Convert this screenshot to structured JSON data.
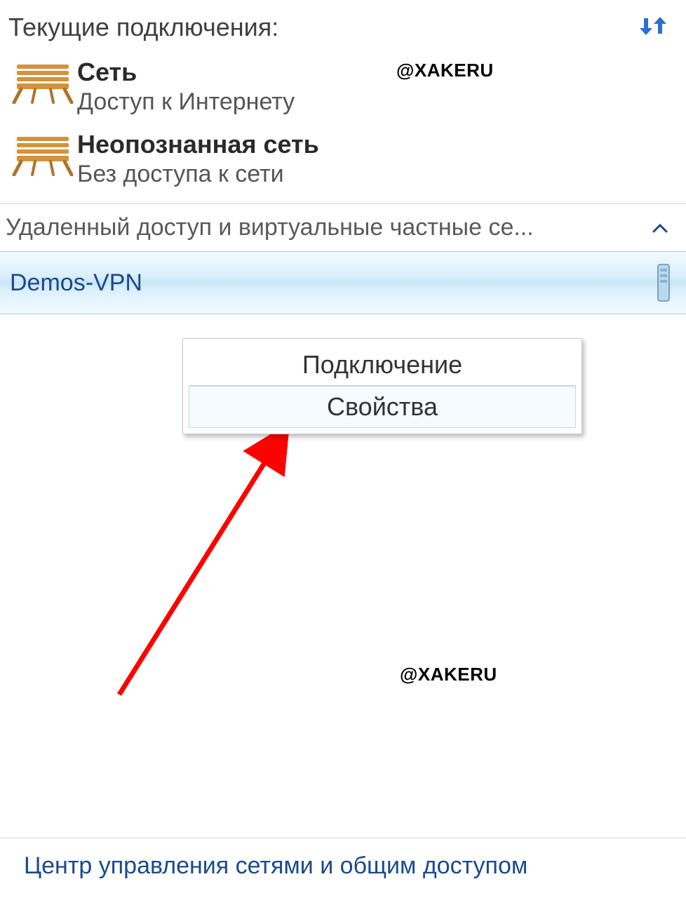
{
  "header": {
    "title": "Текущие подключения:",
    "refresh_icon": "refresh"
  },
  "connections": [
    {
      "name": "Сеть",
      "status": "Доступ к Интернету"
    },
    {
      "name": "Неопознанная сеть",
      "status": "Без доступа к сети"
    }
  ],
  "group": {
    "label": "Удаленный доступ и виртуальные частные се...",
    "expanded": true
  },
  "vpn": {
    "name": "Demos-VPN"
  },
  "context_menu": {
    "items": [
      {
        "label": "Подключение"
      },
      {
        "label": "Свойства"
      }
    ]
  },
  "footer": {
    "link": "Центр управления сетями и общим доступом"
  },
  "watermark": "@XAKERU"
}
